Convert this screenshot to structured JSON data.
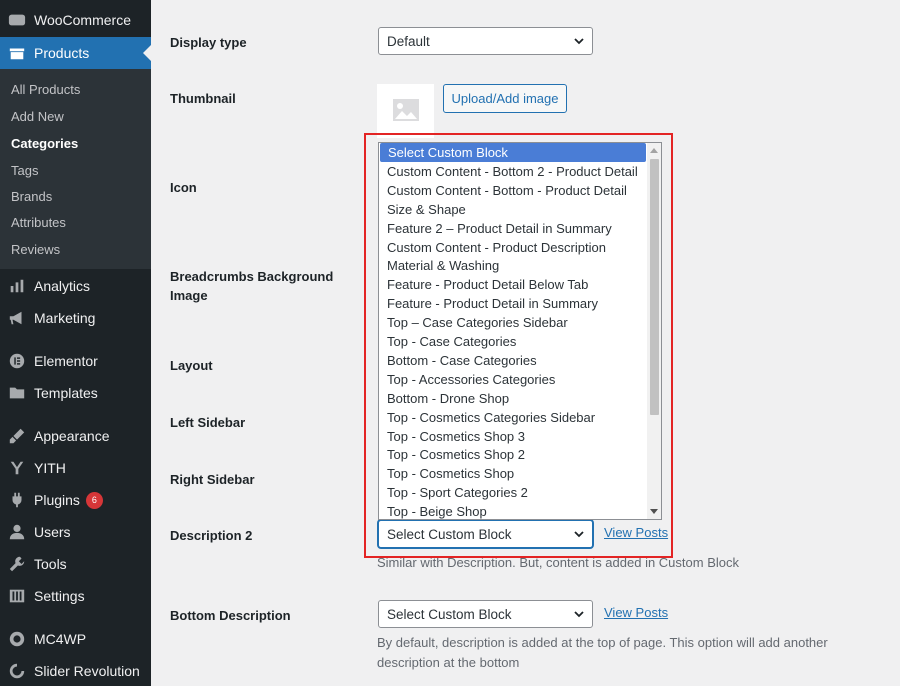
{
  "sidebar": {
    "woocommerce": "WooCommerce",
    "products": "Products",
    "submenu": [
      "All Products",
      "Add New",
      "Categories",
      "Tags",
      "Brands",
      "Attributes",
      "Reviews"
    ],
    "analytics": "Analytics",
    "marketing": "Marketing",
    "elementor": "Elementor",
    "templates": "Templates",
    "appearance": "Appearance",
    "yith": "YITH",
    "plugins": "Plugins",
    "plugins_badge": "6",
    "users": "Users",
    "tools": "Tools",
    "settings": "Settings",
    "mc4wp": "MC4WP",
    "slider_revolution": "Slider Revolution"
  },
  "form": {
    "display_type": {
      "label": "Display type",
      "value": "Default"
    },
    "thumbnail": {
      "label": "Thumbnail",
      "button": "Upload/Add image"
    },
    "icon": {
      "label": "Icon"
    },
    "breadcrumbs": {
      "label_line1": "Breadcrumbs Background",
      "label_line2": "Image"
    },
    "layout": {
      "label": "Layout"
    },
    "left_sidebar": {
      "label": "Left Sidebar"
    },
    "right_sidebar": {
      "label": "Right Sidebar"
    },
    "description2": {
      "label": "Description 2",
      "value": "Select Custom Block",
      "link": "View Posts",
      "help": "Similar with Description. But, content is added in Custom Block"
    },
    "bottom_description": {
      "label": "Bottom Description",
      "value": "Select Custom Block",
      "link": "View Posts",
      "help_line1": "By default, description is added at the top of page. This option will add another",
      "help_line2": "description at the bottom"
    }
  },
  "dropdown": {
    "options": [
      "Select Custom Block",
      "Custom Content - Bottom 2 - Product Detail",
      "Custom Content - Bottom - Product Detail",
      "Size & Shape",
      "Feature 2 – Product Detail in Summary",
      "Custom Content - Product Description",
      "Material & Washing",
      "Feature - Product Detail Below Tab",
      "Feature - Product Detail in Summary",
      "Top – Case Categories Sidebar",
      "Top - Case Categories",
      "Bottom - Case Categories",
      "Top - Accessories Categories",
      "Bottom - Drone Shop",
      "Top - Cosmetics Categories Sidebar",
      "Top - Cosmetics Shop 3",
      "Top - Cosmetics Shop 2",
      "Top - Cosmetics Shop",
      "Top - Sport Categories 2",
      "Top - Beige Shop"
    ],
    "selected_index": 0
  },
  "colors": {
    "sidebar_bg": "#1d2327",
    "accent": "#2271b1",
    "highlight": "#e32424",
    "badge": "#d63638"
  }
}
